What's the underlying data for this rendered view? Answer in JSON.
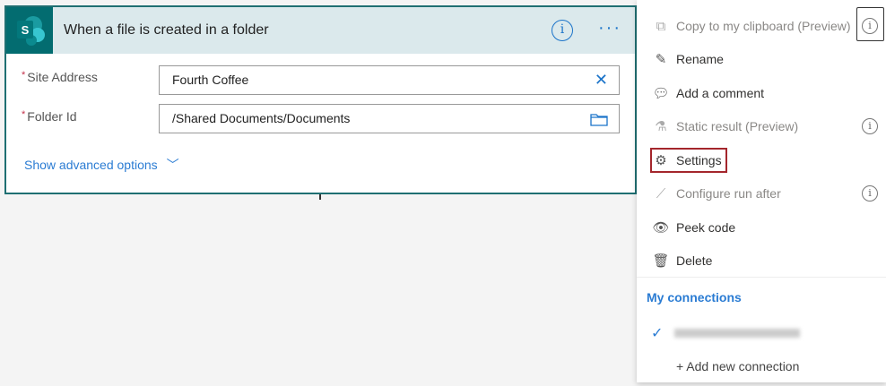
{
  "card": {
    "title": "When a file is created in a folder",
    "logo_letter": "S",
    "fields": [
      {
        "label": "Site Address",
        "value": "Fourth Coffee"
      },
      {
        "label": "Folder Id",
        "value": "/Shared Documents/Documents"
      }
    ],
    "advanced": "Show advanced options"
  },
  "menu": {
    "items": [
      {
        "label": "Copy to my clipboard (Preview)",
        "icon": "copy-icon"
      },
      {
        "label": "Rename",
        "icon": "pencil-icon"
      },
      {
        "label": "Add a comment",
        "icon": "comment-icon"
      },
      {
        "label": "Static result (Preview)",
        "icon": "flask-icon"
      },
      {
        "label": "Settings",
        "icon": "gear-icon"
      },
      {
        "label": "Configure run after",
        "icon": "run-after-icon"
      },
      {
        "label": "Peek code",
        "icon": "eye-icon"
      },
      {
        "label": "Delete",
        "icon": "trash-icon"
      }
    ],
    "connections_header": "My connections",
    "add_connection": "+ Add new connection"
  },
  "colors": {
    "accent": "#2b7cd3",
    "teal": "#036c70",
    "highlight": "#a4262c"
  }
}
